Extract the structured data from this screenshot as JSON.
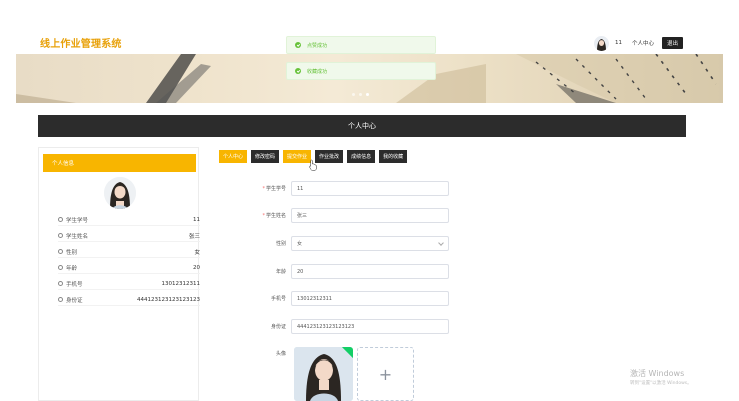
{
  "header": {
    "site_title": "线上作业管理系统",
    "user_name": "11",
    "user_center": "个人中心",
    "logout": "退出"
  },
  "toasts": [
    "点赞成功",
    "收藏成功"
  ],
  "section_title": "个人中心",
  "profile": {
    "card_title": "个人信息",
    "rows": [
      {
        "label": "学生学号",
        "value": "11"
      },
      {
        "label": "学生姓名",
        "value": "张三"
      },
      {
        "label": "性别",
        "value": "女"
      },
      {
        "label": "年龄",
        "value": "20"
      },
      {
        "label": "手机号",
        "value": "13012312311"
      },
      {
        "label": "身份证",
        "value": "444123123123123123"
      }
    ]
  },
  "tabs": [
    "个人中心",
    "修改密码",
    "提交作业",
    "作业批改",
    "成绩信息",
    "我的收藏"
  ],
  "form": {
    "student_no_label": "学生学号",
    "student_no": "11",
    "student_name_label": "学生姓名",
    "student_name": "张三",
    "gender_label": "性别",
    "gender": "女",
    "age_label": "年龄",
    "age": "20",
    "phone_label": "手机号",
    "phone": "13012312311",
    "id_label": "身份证",
    "id_card": "444123123123123123",
    "avatar_label": "头像",
    "add_symbol": "+"
  },
  "watermark": {
    "title": "激活 Windows",
    "subtitle": "转到\"设置\"以激活 Windows。"
  },
  "colors": {
    "accent": "#f8b500",
    "title_color": "#e8a10a",
    "dark": "#2c2c2c",
    "success": "#67c23a"
  }
}
